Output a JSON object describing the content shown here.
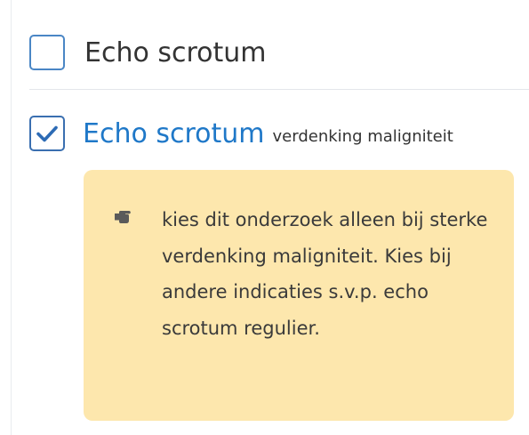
{
  "options": [
    {
      "label": "Echo scrotum",
      "checked": false
    },
    {
      "label": "Echo scrotum",
      "sublabel": "verdenking maligniteit",
      "checked": true
    }
  ],
  "note": {
    "icon": "pointing-hand-icon",
    "text": "kies dit onderzoek alleen bij sterke verdenking maligniteit. Kies bij andere indicaties s.v.p. echo scrotum regulier."
  },
  "colors": {
    "checkbox_border": "#4a86c5",
    "checkmark": "#2d6bb5",
    "selected_label": "#1f78c8",
    "note_background": "#fde7ad"
  }
}
